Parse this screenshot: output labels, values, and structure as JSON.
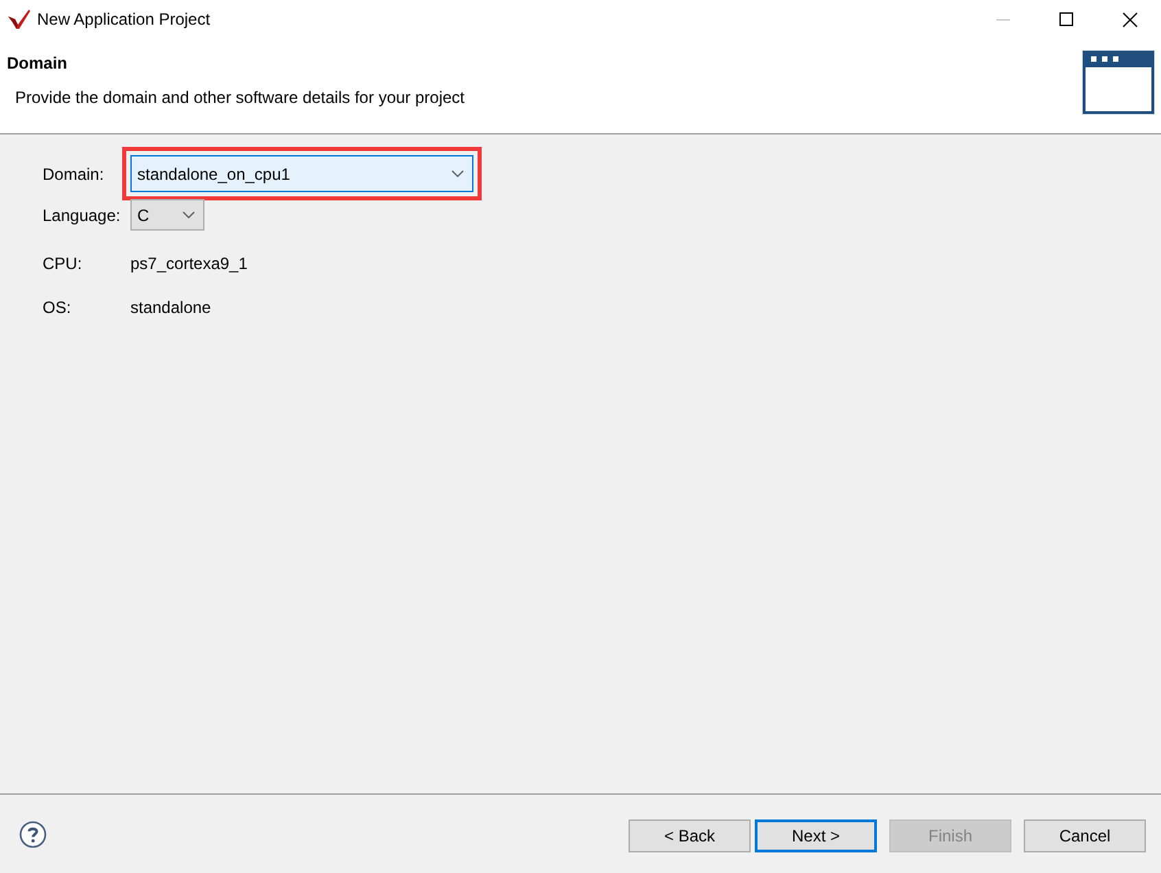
{
  "window": {
    "title": "New Application Project",
    "caption_buttons": [
      {
        "kind": "minimize",
        "disabled": true
      },
      {
        "kind": "maximize",
        "disabled": false
      },
      {
        "kind": "close",
        "disabled": false
      }
    ]
  },
  "header": {
    "title": "Domain",
    "description": "Provide the domain and other software details for your project"
  },
  "form": {
    "selectors": [
      {
        "label": "Domain:",
        "value": "standalone_on_cpu1",
        "focused": true,
        "highlighted": true
      },
      {
        "label": "Language:",
        "value": "C",
        "focused": false,
        "highlighted": false
      }
    ],
    "details": [
      {
        "label": "CPU:",
        "value": "ps7_cortexa9_1"
      },
      {
        "label": "OS:",
        "value": "standalone"
      }
    ]
  },
  "buttons": [
    {
      "label": "< Back",
      "default": false,
      "disabled": false
    },
    {
      "label": "Next >",
      "default": true,
      "disabled": false
    },
    {
      "label": "Finish",
      "default": false,
      "disabled": true
    },
    {
      "label": "Cancel",
      "default": false,
      "disabled": false
    }
  ]
}
